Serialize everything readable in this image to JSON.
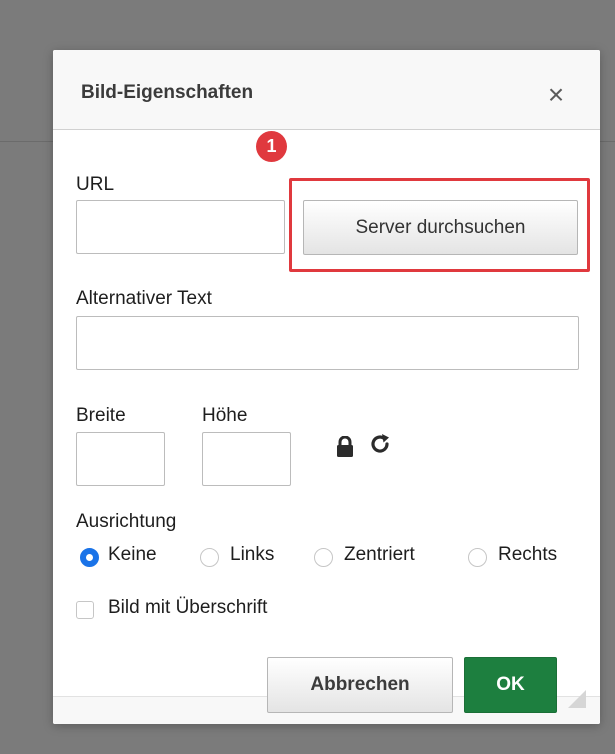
{
  "dialog": {
    "title": "Bild-Eigenschaften",
    "close_icon": "close-icon",
    "badge": "1"
  },
  "fields": {
    "url_label": "URL",
    "url_value": "",
    "browse_button": "Server durchsuchen",
    "alt_label": "Alternativer Text",
    "alt_value": "",
    "width_label": "Breite",
    "width_value": "",
    "height_label": "Höhe",
    "height_value": "",
    "lock_icon": "lock-icon",
    "reset_icon": "reset-size-icon"
  },
  "alignment": {
    "label": "Ausrichtung",
    "options": [
      "Keine",
      "Links",
      "Zentriert",
      "Rechts"
    ],
    "selected": "Keine"
  },
  "caption_checkbox": {
    "label": "Bild mit Überschrift",
    "checked": false
  },
  "footer": {
    "cancel_button": "Abbrechen",
    "ok_button": "OK"
  },
  "colors": {
    "badge": "#e0393e",
    "highlight": "#e0393e",
    "ok_button": "#1d7f3f",
    "radio_selected": "#1a73e8"
  }
}
